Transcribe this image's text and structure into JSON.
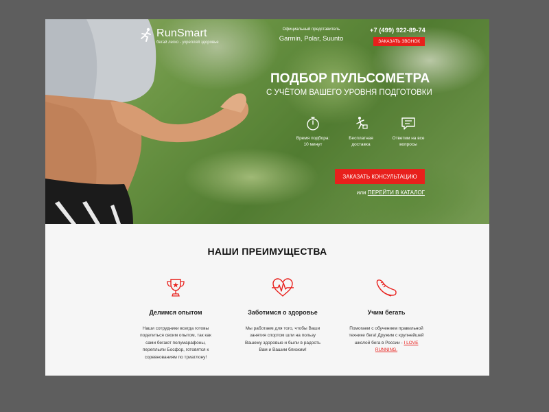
{
  "header": {
    "logo_name": "RunSmart",
    "logo_sub": "бегай легко - укрепляй здоровье",
    "dealer_title": "Официальный представитель",
    "dealer_brands": "Garmin, Polar, Suunto",
    "phone": "+7 (499) 922-89-74",
    "call_button": "ЗАКАЗАТЬ ЗВОНОК"
  },
  "hero": {
    "title": "ПОДБОР ПУЛЬСОМЕТРА",
    "subtitle": "С УЧЁТОМ ВАШЕГО УРОВНЯ ПОДГОТОВКИ",
    "features": [
      {
        "icon": "stopwatch-icon",
        "line1": "Время подбора:",
        "line2": "10 минут"
      },
      {
        "icon": "runner-delivery-icon",
        "line1": "Бесплатная",
        "line2": "доставка"
      },
      {
        "icon": "chat-icon",
        "line1": "Ответим на все",
        "line2": "вопросы"
      }
    ],
    "consult_button": "ЗАКАЗАТЬ КОНСУЛЬТАЦИЮ",
    "catalog_prefix": "или",
    "catalog_link": "ПЕРЕЙТИ В КАТАЛОГ"
  },
  "advantages": {
    "title": "НАШИ ПРЕИМУЩЕСТВА",
    "items": [
      {
        "icon": "trophy-icon",
        "heading": "Делимся опытом",
        "text": "Наши сотрудники всегда готовы поделиться своим опытом, так как сами бегают полумарафоны, переплыли Босфор, готовятся к соревнованиям по триатлону!"
      },
      {
        "icon": "heart-pulse-icon",
        "heading": "Заботимся о здоровье",
        "text": "Мы работаем для того, чтобы Ваши занятия спортом шли на пользу Вашему здоровью и были в радость Вам и Вашим близким!"
      },
      {
        "icon": "running-shoe-icon",
        "heading": "Учим бегать",
        "text": "Помогаем с обучением правильной технике бега! Дружим с крупнейшей школой бега в России -",
        "link": "I LOVE RUNNING."
      }
    ]
  },
  "colors": {
    "accent": "#e8201c",
    "page_bg": "#f6f6f6",
    "outer_bg": "#5e5e5e"
  }
}
